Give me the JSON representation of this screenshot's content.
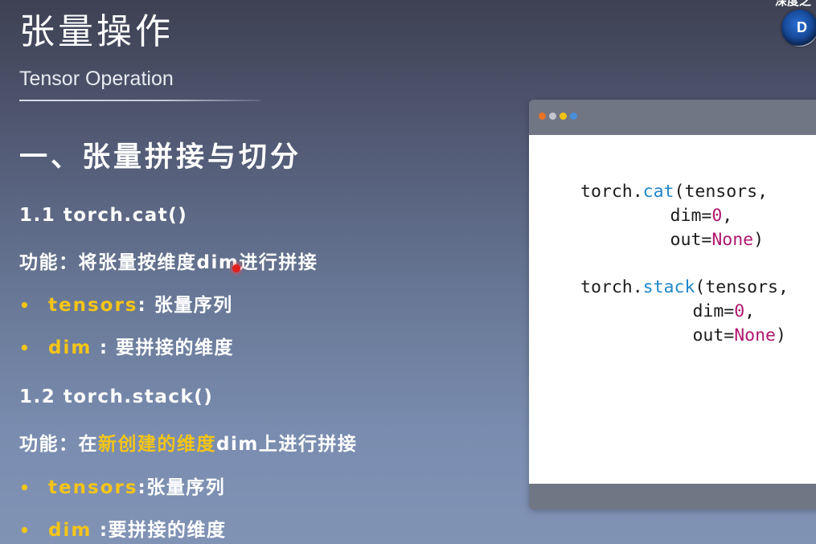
{
  "slide": {
    "title": "张量操作",
    "subtitle": "Tensor Operation",
    "corner_text": "深度之",
    "logo_letter": "D"
  },
  "section": {
    "heading": "一、张量拼接与切分"
  },
  "items": [
    {
      "heading": "1.1 torch.cat()",
      "function_prefix": "功能：将张量按维度dim进行拼接",
      "params": [
        {
          "name": "tensors",
          "desc": ": 张量序列"
        },
        {
          "name": "dim",
          "desc": " : 要拼接的维度"
        }
      ]
    },
    {
      "heading": "1.2 torch.stack()",
      "function_prefix": "功能：在",
      "function_highlight": "新创建的维度",
      "function_suffix": "dim上进行拼接",
      "params": [
        {
          "name": "tensors",
          "desc": ":张量序列"
        },
        {
          "name": "dim",
          "desc": " :要拼接的维度"
        }
      ]
    }
  ],
  "bullet_glyph": "•",
  "code": {
    "lines": [
      {
        "pre": "torch.",
        "fn": "cat",
        "post": "(tensors,"
      },
      {
        "pre": "        dim=",
        "kw": "0",
        "post": ","
      },
      {
        "pre": "        out=",
        "kw": "None",
        "post": ")"
      },
      {
        "pre": "torch.",
        "fn": "stack",
        "post": "(tensors,"
      },
      {
        "pre": "          dim=",
        "kw": "0",
        "post": ","
      },
      {
        "pre": "          out=",
        "kw": "None",
        "post": ")"
      }
    ]
  },
  "colors": {
    "highlight": "#f5c518",
    "code_function": "#2188c8",
    "code_keyword": "#b0186e",
    "window_dots": [
      "#e8732a",
      "#c2c5cc",
      "#f2c316",
      "#4a8fd8"
    ]
  }
}
